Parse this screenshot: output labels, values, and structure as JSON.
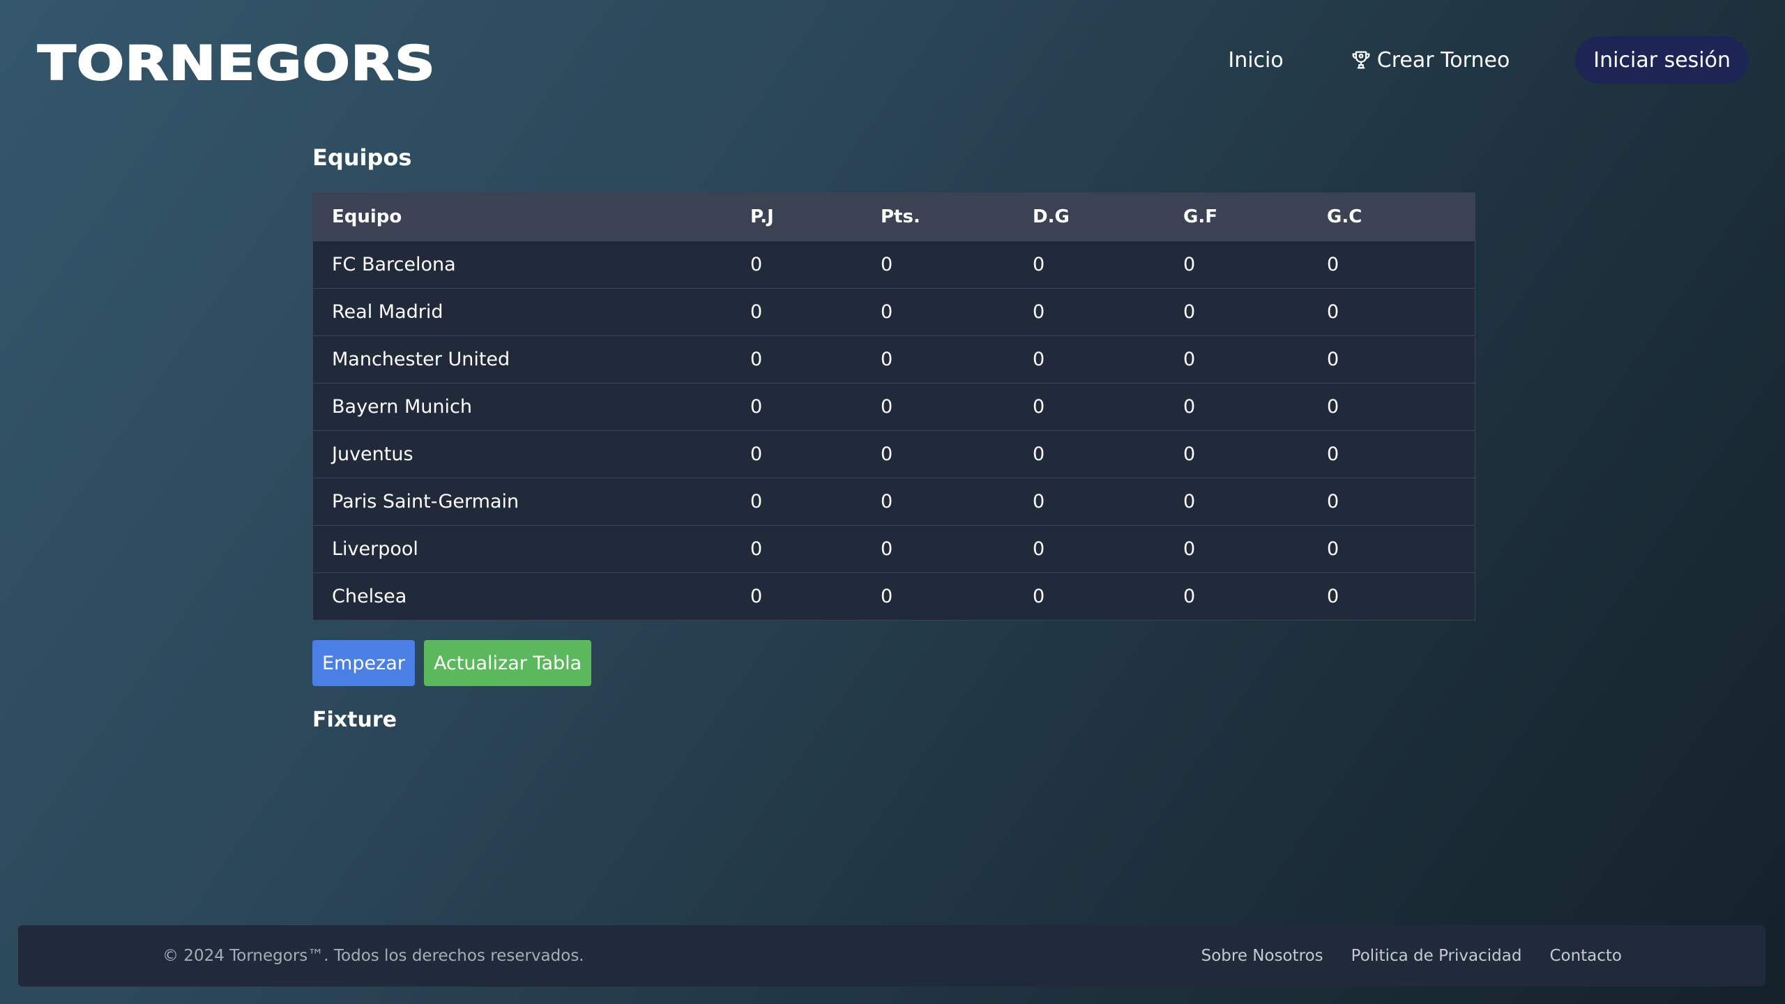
{
  "header": {
    "logo": "TORNEGORS",
    "nav": {
      "home": "Inicio",
      "create_tournament": "Crear Torneo",
      "login": "Iniciar sesión"
    }
  },
  "teams_section": {
    "title": "Equipos",
    "columns": [
      "Equipo",
      "P.J",
      "Pts.",
      "D.G",
      "G.F",
      "G.C"
    ],
    "rows": [
      {
        "team": "FC Barcelona",
        "pj": "0",
        "pts": "0",
        "dg": "0",
        "gf": "0",
        "gc": "0"
      },
      {
        "team": "Real Madrid",
        "pj": "0",
        "pts": "0",
        "dg": "0",
        "gf": "0",
        "gc": "0"
      },
      {
        "team": "Manchester United",
        "pj": "0",
        "pts": "0",
        "dg": "0",
        "gf": "0",
        "gc": "0"
      },
      {
        "team": "Bayern Munich",
        "pj": "0",
        "pts": "0",
        "dg": "0",
        "gf": "0",
        "gc": "0"
      },
      {
        "team": "Juventus",
        "pj": "0",
        "pts": "0",
        "dg": "0",
        "gf": "0",
        "gc": "0"
      },
      {
        "team": "Paris Saint-Germain",
        "pj": "0",
        "pts": "0",
        "dg": "0",
        "gf": "0",
        "gc": "0"
      },
      {
        "team": "Liverpool",
        "pj": "0",
        "pts": "0",
        "dg": "0",
        "gf": "0",
        "gc": "0"
      },
      {
        "team": "Chelsea",
        "pj": "0",
        "pts": "0",
        "dg": "0",
        "gf": "0",
        "gc": "0"
      }
    ]
  },
  "actions": {
    "start": "Empezar",
    "update_table": "Actualizar Tabla"
  },
  "fixture_section": {
    "title": "Fixture"
  },
  "footer": {
    "copyright": "© 2024 Tornegors™. Todos los derechos reservados.",
    "links": {
      "about": "Sobre Nosotros",
      "privacy": "Politica de Privacidad",
      "contact": "Contacto"
    }
  },
  "colors": {
    "login_button_bg": "#1c2554",
    "start_button_bg": "#4a7fe6",
    "update_button_bg": "#5cb85c",
    "table_header_bg": "#3a4253",
    "table_row_bg": "#212a3b",
    "footer_bg": "#202a3a"
  },
  "icons": {
    "create_tournament": "trophy-icon"
  }
}
